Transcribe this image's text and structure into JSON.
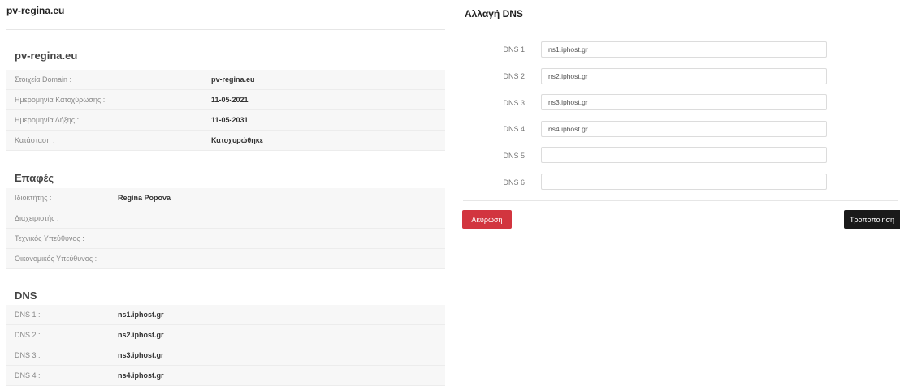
{
  "domain_panel": {
    "title": "pv-regina.eu",
    "heading": "pv-regina.eu",
    "info_rows": [
      {
        "label": "Στοιχεία Domain :",
        "value": "pv-regina.eu"
      },
      {
        "label": "Ημερομηνία Κατοχύρωσης :",
        "value": "11-05-2021"
      },
      {
        "label": "Ημερομηνία Λήξης :",
        "value": "11-05-2031"
      },
      {
        "label": "Κατάσταση :",
        "value": "Κατοχυρώθηκε"
      }
    ]
  },
  "contacts": {
    "heading": "Επαφές",
    "rows": [
      {
        "label": "Ιδιοκτήτης :",
        "value": "Regina Popova"
      },
      {
        "label": "Διαχειριστής :",
        "value": ""
      },
      {
        "label": "Τεχνικός Υπεύθυνος :",
        "value": ""
      },
      {
        "label": "Οικονομικός Υπεύθυνος :",
        "value": ""
      }
    ]
  },
  "dns_info": {
    "heading": "DNS",
    "rows": [
      {
        "label": "DNS 1 :",
        "value": "ns1.iphost.gr"
      },
      {
        "label": "DNS 2 :",
        "value": "ns2.iphost.gr"
      },
      {
        "label": "DNS 3 :",
        "value": "ns3.iphost.gr"
      },
      {
        "label": "DNS 4 :",
        "value": "ns4.iphost.gr"
      }
    ]
  },
  "change_dns": {
    "title": "Αλλαγή DNS",
    "fields": [
      {
        "label": "DNS 1",
        "value": "ns1.iphost.gr"
      },
      {
        "label": "DNS 2",
        "value": "ns2.iphost.gr"
      },
      {
        "label": "DNS 3",
        "value": "ns3.iphost.gr"
      },
      {
        "label": "DNS 4",
        "value": "ns4.iphost.gr"
      },
      {
        "label": "DNS 5",
        "value": ""
      },
      {
        "label": "DNS 6",
        "value": ""
      }
    ],
    "cancel_label": "Ακύρωση",
    "submit_label": "Τροποποίηση"
  },
  "colors": {
    "cancel": "#d2353f",
    "submit": "#1a1a1a",
    "row_shade": "#f7f7f7"
  }
}
